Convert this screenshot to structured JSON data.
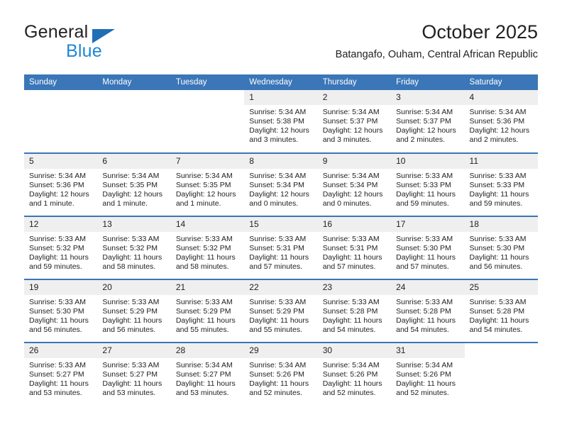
{
  "brand": {
    "name_part1": "General",
    "name_part2": "Blue",
    "triangle_color": "#1f6fb5",
    "blue_color": "#2186d4"
  },
  "header": {
    "title": "October 2025",
    "subtitle": "Batangafo, Ouham, Central African Republic",
    "header_bg": "#3a76b8",
    "daynum_bg": "#efefef"
  },
  "weekdays": [
    "Sunday",
    "Monday",
    "Tuesday",
    "Wednesday",
    "Thursday",
    "Friday",
    "Saturday"
  ],
  "weeks": [
    [
      {
        "day": "",
        "sunrise": "",
        "sunset": "",
        "daylight1": "",
        "daylight2": "",
        "empty": true
      },
      {
        "day": "",
        "sunrise": "",
        "sunset": "",
        "daylight1": "",
        "daylight2": "",
        "empty": true
      },
      {
        "day": "",
        "sunrise": "",
        "sunset": "",
        "daylight1": "",
        "daylight2": "",
        "empty": true
      },
      {
        "day": "1",
        "sunrise": "Sunrise: 5:34 AM",
        "sunset": "Sunset: 5:38 PM",
        "daylight1": "Daylight: 12 hours",
        "daylight2": "and 3 minutes.",
        "empty": false
      },
      {
        "day": "2",
        "sunrise": "Sunrise: 5:34 AM",
        "sunset": "Sunset: 5:37 PM",
        "daylight1": "Daylight: 12 hours",
        "daylight2": "and 3 minutes.",
        "empty": false
      },
      {
        "day": "3",
        "sunrise": "Sunrise: 5:34 AM",
        "sunset": "Sunset: 5:37 PM",
        "daylight1": "Daylight: 12 hours",
        "daylight2": "and 2 minutes.",
        "empty": false
      },
      {
        "day": "4",
        "sunrise": "Sunrise: 5:34 AM",
        "sunset": "Sunset: 5:36 PM",
        "daylight1": "Daylight: 12 hours",
        "daylight2": "and 2 minutes.",
        "empty": false
      }
    ],
    [
      {
        "day": "5",
        "sunrise": "Sunrise: 5:34 AM",
        "sunset": "Sunset: 5:36 PM",
        "daylight1": "Daylight: 12 hours",
        "daylight2": "and 1 minute.",
        "empty": false
      },
      {
        "day": "6",
        "sunrise": "Sunrise: 5:34 AM",
        "sunset": "Sunset: 5:35 PM",
        "daylight1": "Daylight: 12 hours",
        "daylight2": "and 1 minute.",
        "empty": false
      },
      {
        "day": "7",
        "sunrise": "Sunrise: 5:34 AM",
        "sunset": "Sunset: 5:35 PM",
        "daylight1": "Daylight: 12 hours",
        "daylight2": "and 1 minute.",
        "empty": false
      },
      {
        "day": "8",
        "sunrise": "Sunrise: 5:34 AM",
        "sunset": "Sunset: 5:34 PM",
        "daylight1": "Daylight: 12 hours",
        "daylight2": "and 0 minutes.",
        "empty": false
      },
      {
        "day": "9",
        "sunrise": "Sunrise: 5:34 AM",
        "sunset": "Sunset: 5:34 PM",
        "daylight1": "Daylight: 12 hours",
        "daylight2": "and 0 minutes.",
        "empty": false
      },
      {
        "day": "10",
        "sunrise": "Sunrise: 5:33 AM",
        "sunset": "Sunset: 5:33 PM",
        "daylight1": "Daylight: 11 hours",
        "daylight2": "and 59 minutes.",
        "empty": false
      },
      {
        "day": "11",
        "sunrise": "Sunrise: 5:33 AM",
        "sunset": "Sunset: 5:33 PM",
        "daylight1": "Daylight: 11 hours",
        "daylight2": "and 59 minutes.",
        "empty": false
      }
    ],
    [
      {
        "day": "12",
        "sunrise": "Sunrise: 5:33 AM",
        "sunset": "Sunset: 5:32 PM",
        "daylight1": "Daylight: 11 hours",
        "daylight2": "and 59 minutes.",
        "empty": false
      },
      {
        "day": "13",
        "sunrise": "Sunrise: 5:33 AM",
        "sunset": "Sunset: 5:32 PM",
        "daylight1": "Daylight: 11 hours",
        "daylight2": "and 58 minutes.",
        "empty": false
      },
      {
        "day": "14",
        "sunrise": "Sunrise: 5:33 AM",
        "sunset": "Sunset: 5:32 PM",
        "daylight1": "Daylight: 11 hours",
        "daylight2": "and 58 minutes.",
        "empty": false
      },
      {
        "day": "15",
        "sunrise": "Sunrise: 5:33 AM",
        "sunset": "Sunset: 5:31 PM",
        "daylight1": "Daylight: 11 hours",
        "daylight2": "and 57 minutes.",
        "empty": false
      },
      {
        "day": "16",
        "sunrise": "Sunrise: 5:33 AM",
        "sunset": "Sunset: 5:31 PM",
        "daylight1": "Daylight: 11 hours",
        "daylight2": "and 57 minutes.",
        "empty": false
      },
      {
        "day": "17",
        "sunrise": "Sunrise: 5:33 AM",
        "sunset": "Sunset: 5:30 PM",
        "daylight1": "Daylight: 11 hours",
        "daylight2": "and 57 minutes.",
        "empty": false
      },
      {
        "day": "18",
        "sunrise": "Sunrise: 5:33 AM",
        "sunset": "Sunset: 5:30 PM",
        "daylight1": "Daylight: 11 hours",
        "daylight2": "and 56 minutes.",
        "empty": false
      }
    ],
    [
      {
        "day": "19",
        "sunrise": "Sunrise: 5:33 AM",
        "sunset": "Sunset: 5:30 PM",
        "daylight1": "Daylight: 11 hours",
        "daylight2": "and 56 minutes.",
        "empty": false
      },
      {
        "day": "20",
        "sunrise": "Sunrise: 5:33 AM",
        "sunset": "Sunset: 5:29 PM",
        "daylight1": "Daylight: 11 hours",
        "daylight2": "and 56 minutes.",
        "empty": false
      },
      {
        "day": "21",
        "sunrise": "Sunrise: 5:33 AM",
        "sunset": "Sunset: 5:29 PM",
        "daylight1": "Daylight: 11 hours",
        "daylight2": "and 55 minutes.",
        "empty": false
      },
      {
        "day": "22",
        "sunrise": "Sunrise: 5:33 AM",
        "sunset": "Sunset: 5:29 PM",
        "daylight1": "Daylight: 11 hours",
        "daylight2": "and 55 minutes.",
        "empty": false
      },
      {
        "day": "23",
        "sunrise": "Sunrise: 5:33 AM",
        "sunset": "Sunset: 5:28 PM",
        "daylight1": "Daylight: 11 hours",
        "daylight2": "and 54 minutes.",
        "empty": false
      },
      {
        "day": "24",
        "sunrise": "Sunrise: 5:33 AM",
        "sunset": "Sunset: 5:28 PM",
        "daylight1": "Daylight: 11 hours",
        "daylight2": "and 54 minutes.",
        "empty": false
      },
      {
        "day": "25",
        "sunrise": "Sunrise: 5:33 AM",
        "sunset": "Sunset: 5:28 PM",
        "daylight1": "Daylight: 11 hours",
        "daylight2": "and 54 minutes.",
        "empty": false
      }
    ],
    [
      {
        "day": "26",
        "sunrise": "Sunrise: 5:33 AM",
        "sunset": "Sunset: 5:27 PM",
        "daylight1": "Daylight: 11 hours",
        "daylight2": "and 53 minutes.",
        "empty": false
      },
      {
        "day": "27",
        "sunrise": "Sunrise: 5:33 AM",
        "sunset": "Sunset: 5:27 PM",
        "daylight1": "Daylight: 11 hours",
        "daylight2": "and 53 minutes.",
        "empty": false
      },
      {
        "day": "28",
        "sunrise": "Sunrise: 5:34 AM",
        "sunset": "Sunset: 5:27 PM",
        "daylight1": "Daylight: 11 hours",
        "daylight2": "and 53 minutes.",
        "empty": false
      },
      {
        "day": "29",
        "sunrise": "Sunrise: 5:34 AM",
        "sunset": "Sunset: 5:26 PM",
        "daylight1": "Daylight: 11 hours",
        "daylight2": "and 52 minutes.",
        "empty": false
      },
      {
        "day": "30",
        "sunrise": "Sunrise: 5:34 AM",
        "sunset": "Sunset: 5:26 PM",
        "daylight1": "Daylight: 11 hours",
        "daylight2": "and 52 minutes.",
        "empty": false
      },
      {
        "day": "31",
        "sunrise": "Sunrise: 5:34 AM",
        "sunset": "Sunset: 5:26 PM",
        "daylight1": "Daylight: 11 hours",
        "daylight2": "and 52 minutes.",
        "empty": false
      },
      {
        "day": "",
        "sunrise": "",
        "sunset": "",
        "daylight1": "",
        "daylight2": "",
        "empty": true
      }
    ]
  ]
}
